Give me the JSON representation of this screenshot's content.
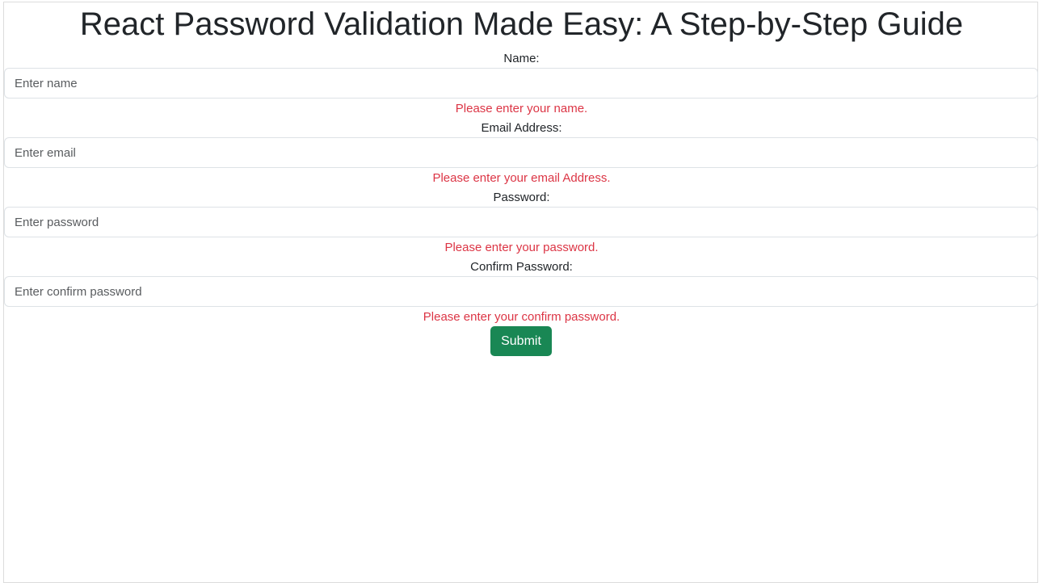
{
  "page": {
    "title": "React Password Validation Made Easy: A Step-by-Step Guide"
  },
  "form": {
    "name": {
      "label": "Name:",
      "placeholder": "Enter name",
      "value": "",
      "error": "Please enter your name."
    },
    "email": {
      "label": "Email Address:",
      "placeholder": "Enter email",
      "value": "",
      "error": "Please enter your email Address."
    },
    "password": {
      "label": "Password:",
      "placeholder": "Enter password",
      "value": "",
      "error": "Please enter your password."
    },
    "confirm_password": {
      "label": "Confirm Password:",
      "placeholder": "Enter confirm password",
      "value": "",
      "error": "Please enter your confirm password."
    },
    "submit_label": "Submit"
  },
  "colors": {
    "error": "#dc3545",
    "submit_background": "#198754",
    "text": "#212529"
  }
}
